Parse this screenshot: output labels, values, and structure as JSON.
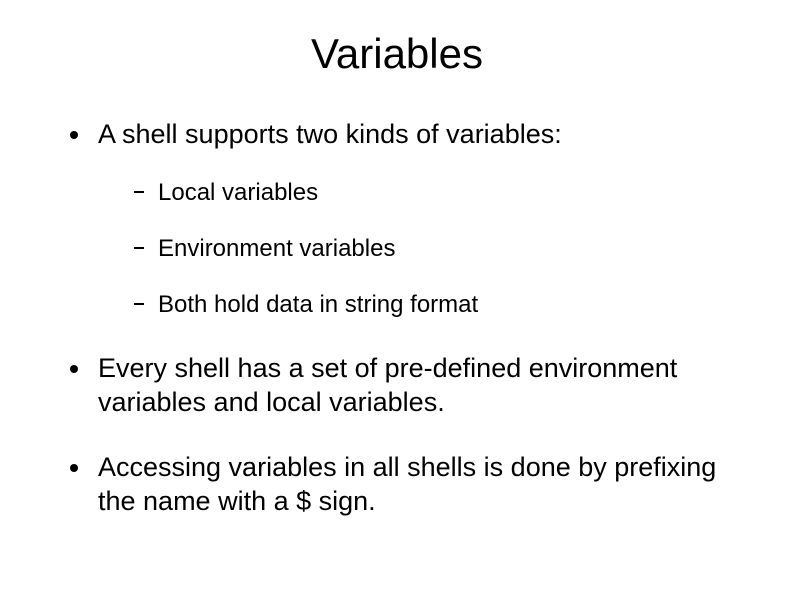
{
  "title": "Variables",
  "bullets": [
    {
      "text": "A shell supports two kinds of variables:",
      "children": [
        {
          "text": "Local variables"
        },
        {
          "text": "Environment variables"
        },
        {
          "text": "Both hold data in string format"
        }
      ]
    },
    {
      "text": "Every shell has a set of pre-defined environment variables and local variables."
    },
    {
      "text": "Accessing variables in all shells is done by prefixing the name with a $ sign."
    }
  ]
}
